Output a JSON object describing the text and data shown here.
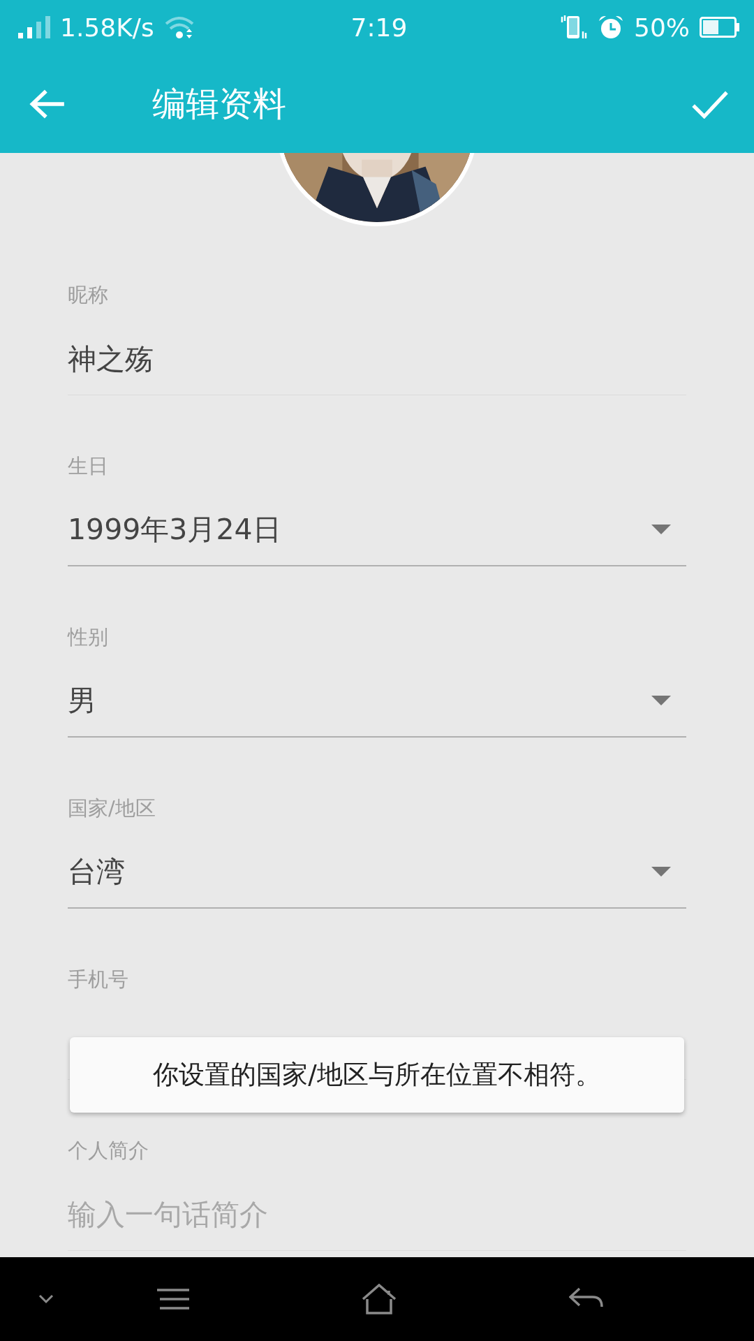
{
  "status_bar": {
    "network_speed": "1.58K/s",
    "time": "7:19",
    "battery": "50%"
  },
  "toolbar": {
    "title": "编辑资料"
  },
  "fields": [
    {
      "kind": "text",
      "label": "昵称",
      "value": "神之殇"
    },
    {
      "kind": "dropdown",
      "label": "生日",
      "value": "1999年3月24日"
    },
    {
      "kind": "dropdown",
      "label": "性别",
      "value": "男"
    },
    {
      "kind": "dropdown",
      "label": "国家/地区",
      "value": "台湾"
    },
    {
      "kind": "text",
      "label": "手机号"
    },
    {
      "kind": "text",
      "label": "个人简介",
      "placeholder": "输入一句话简介"
    }
  ],
  "toast": {
    "message": "你设置的国家/地区与所在位置不相符。"
  }
}
